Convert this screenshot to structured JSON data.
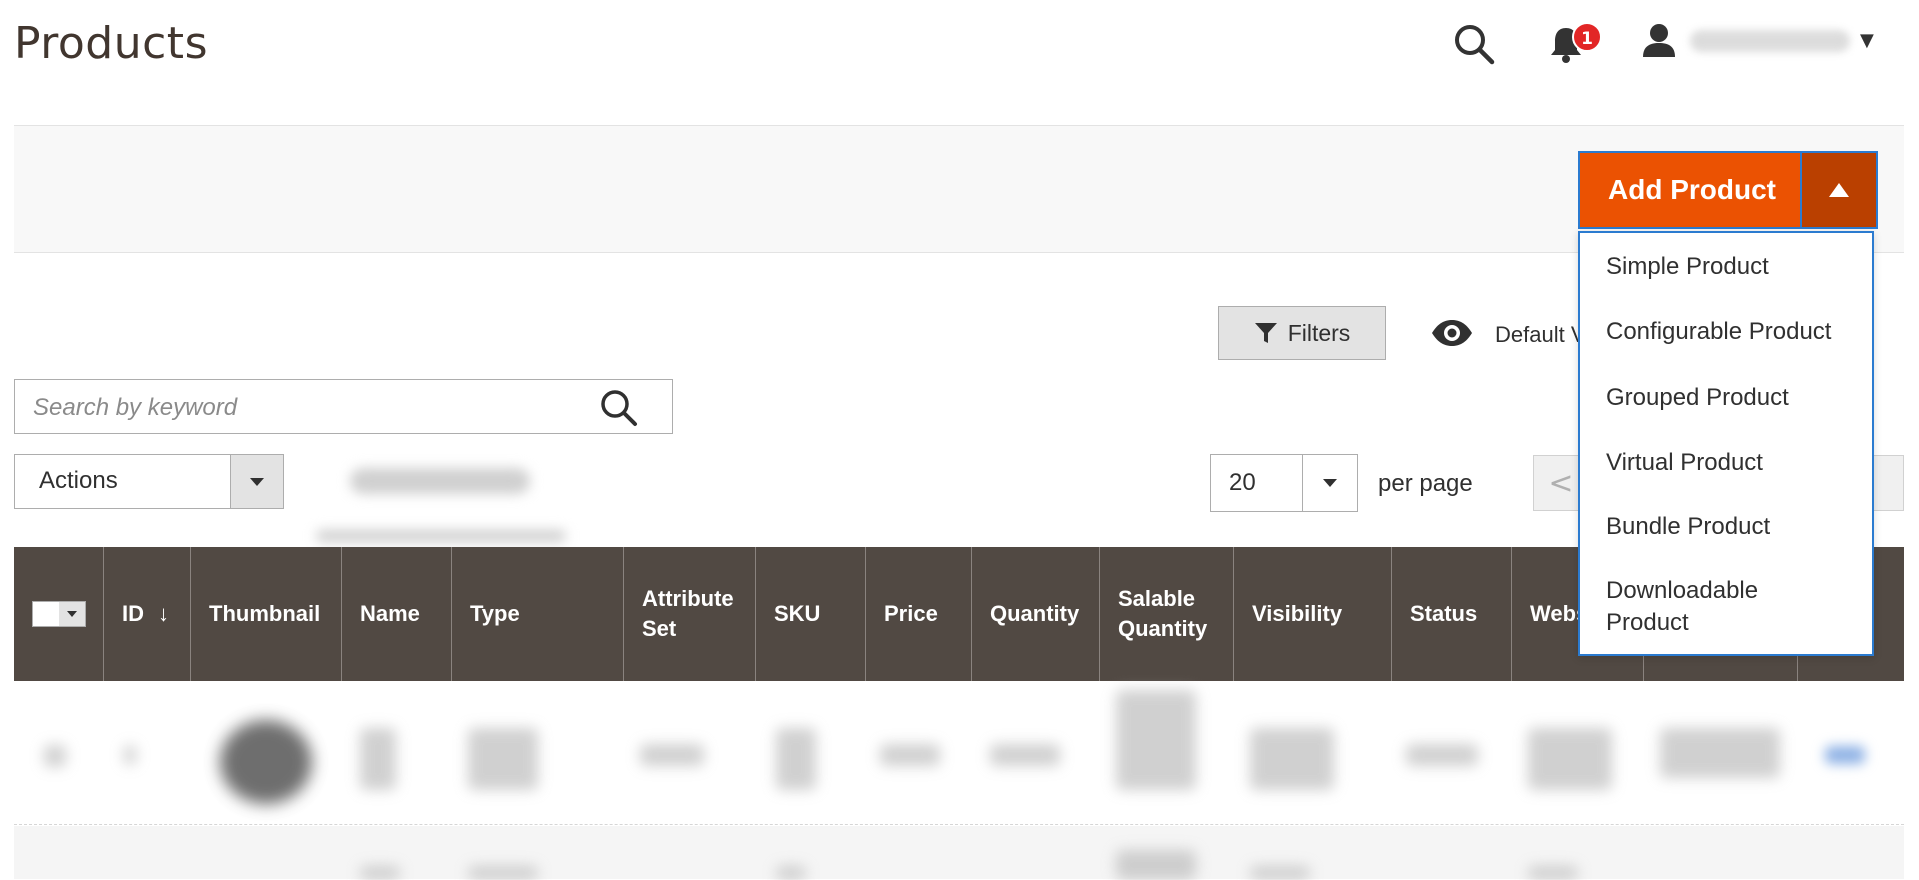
{
  "header": {
    "page_title": "Products",
    "notifications_count": "1"
  },
  "action_bar": {
    "add_product_label": "Add Product",
    "dropdown_items": [
      "Simple Product",
      "Configurable Product",
      "Grouped Product",
      "Virtual Product",
      "Bundle Product",
      "Downloadable Product"
    ]
  },
  "toolbar": {
    "filters_label": "Filters",
    "default_view_label": "Default V",
    "search_placeholder": "Search by keyword",
    "actions_label": "Actions",
    "per_page_value": "20",
    "per_page_label": "per page",
    "pager_prev": "<"
  },
  "grid": {
    "columns": [
      "ID",
      "Thumbnail",
      "Name",
      "Type",
      "Attribute Set",
      "SKU",
      "Price",
      "Quantity",
      "Salable Quantity",
      "Visibility",
      "Status",
      "Webs",
      "",
      ""
    ],
    "sort_indicator": "↓"
  },
  "colors": {
    "accent": "#eb5202",
    "accent_dark": "#ba4000",
    "grid_header": "#514943",
    "badge": "#e22626"
  },
  "icons": {
    "search": "search-icon",
    "bell": "bell-icon",
    "user": "user-icon",
    "filter": "filter-icon",
    "eye": "eye-icon"
  }
}
